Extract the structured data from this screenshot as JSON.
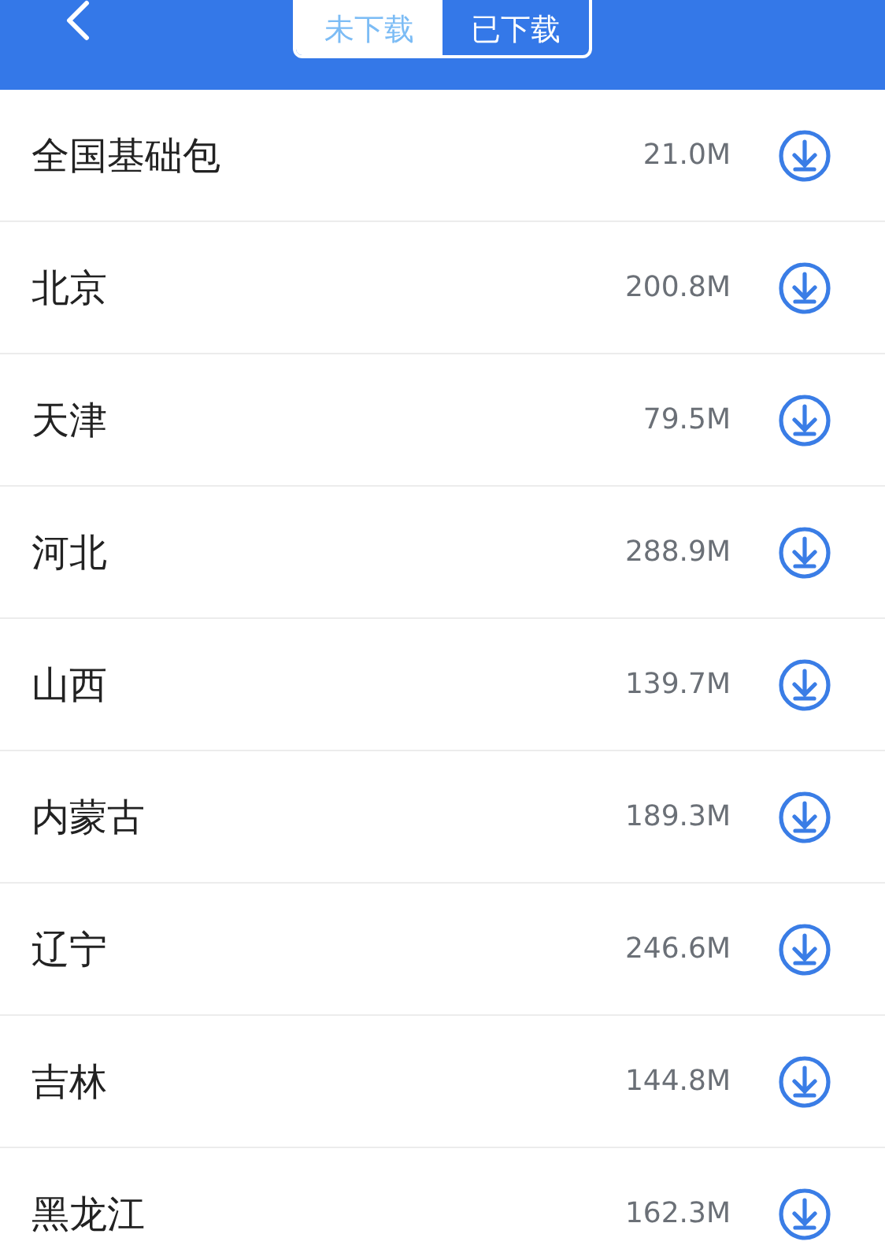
{
  "tabs": [
    {
      "label": "未下载",
      "selected": true
    },
    {
      "label": "已下载",
      "selected": false
    }
  ],
  "regions": [
    {
      "name": "全国基础包",
      "size": "21.0M"
    },
    {
      "name": "北京",
      "size": "200.8M"
    },
    {
      "name": "天津",
      "size": "79.5M"
    },
    {
      "name": "河北",
      "size": "288.9M"
    },
    {
      "name": "山西",
      "size": "139.7M"
    },
    {
      "name": "内蒙古",
      "size": "189.3M"
    },
    {
      "name": "辽宁",
      "size": "246.6M"
    },
    {
      "name": "吉林",
      "size": "144.8M"
    },
    {
      "name": "黑龙江",
      "size": "162.3M"
    }
  ]
}
